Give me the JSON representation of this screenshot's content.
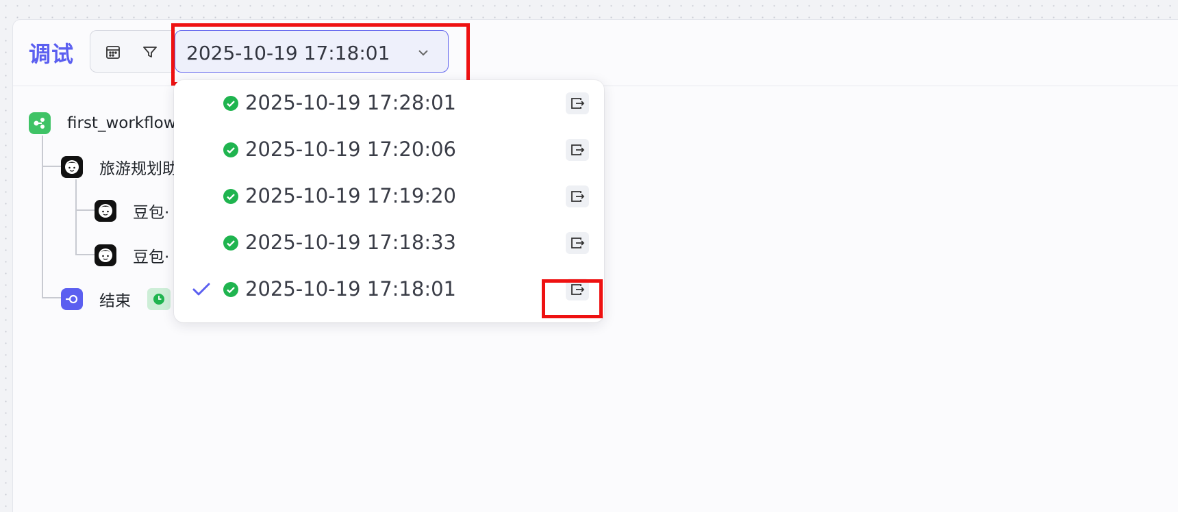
{
  "header": {
    "title": "调试",
    "selected_run": "2025-10-19 17:18:01"
  },
  "tree": {
    "root_label": "first_workflow",
    "agent_label": "旅游规划助",
    "child1_label": "豆包·",
    "child2_label": "豆包·",
    "end_label": "结束"
  },
  "runs": [
    {
      "time": "2025-10-19 17:28:01",
      "status": "success",
      "selected": false
    },
    {
      "time": "2025-10-19 17:20:06",
      "status": "success",
      "selected": false
    },
    {
      "time": "2025-10-19 17:19:20",
      "status": "success",
      "selected": false
    },
    {
      "time": "2025-10-19 17:18:33",
      "status": "success",
      "selected": false
    },
    {
      "time": "2025-10-19 17:18:01",
      "status": "success",
      "selected": true
    }
  ],
  "icons": {
    "toolbar": [
      "calendar-icon",
      "filter-icon"
    ],
    "dropdown": "chevron-down-icon",
    "row_action": "open-run-icon",
    "row_status": "success-check-icon",
    "selected_marker": "checkmark-icon"
  },
  "colors": {
    "accent": "#5b5ff0",
    "success": "#1fb44f",
    "root_node": "#3fc366",
    "end_node": "#5b5ff0",
    "highlight": "#ee1111"
  }
}
